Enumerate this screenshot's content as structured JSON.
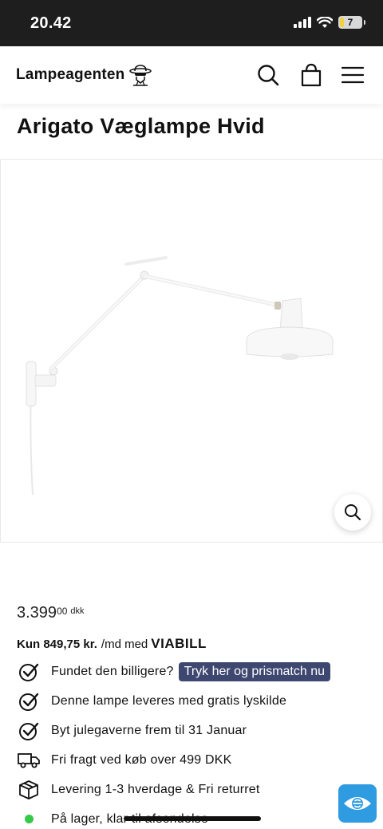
{
  "status_bar": {
    "time": "20.42",
    "battery": "7",
    "battery_level": 0.2
  },
  "header": {
    "logo_text": "Lampeagenten",
    "icons": [
      "search-icon",
      "shopping-bag-icon",
      "hamburger-menu-icon"
    ]
  },
  "product": {
    "title": "Arigato Væglampe Hvid",
    "image_icon": "zoom-icon"
  },
  "pricing": {
    "price_main": "3.399",
    "price_decimals": "00",
    "currency": "dkk"
  },
  "financing": {
    "amount": "Kun 849,75 kr.",
    "rest": "/md med",
    "provider": "VIABILL"
  },
  "usps": [
    {
      "icon": "checkmark-circle-icon",
      "text": "Fundet den billigere?",
      "badge": "Tryk her og prismatch nu"
    },
    {
      "icon": "checkmark-circle-icon",
      "text": "Denne lampe leveres med gratis lyskilde"
    },
    {
      "icon": "checkmark-circle-icon",
      "text": "Byt julegaverne frem til 31 Januar"
    },
    {
      "icon": "truck-icon",
      "text": "Fri fragt ved køb over 499 DKK"
    },
    {
      "icon": "box-icon",
      "text": "Levering 1-3 hverdage & Fri returret"
    },
    {
      "icon": "in-stock-dot-icon",
      "text": "På lager, klar til afsendelse"
    }
  ],
  "colors": {
    "status_bar": "#1e1e1e",
    "badge": "#3d4770",
    "stock_dot": "#36c94a",
    "chat_button": "#2f9be0"
  }
}
